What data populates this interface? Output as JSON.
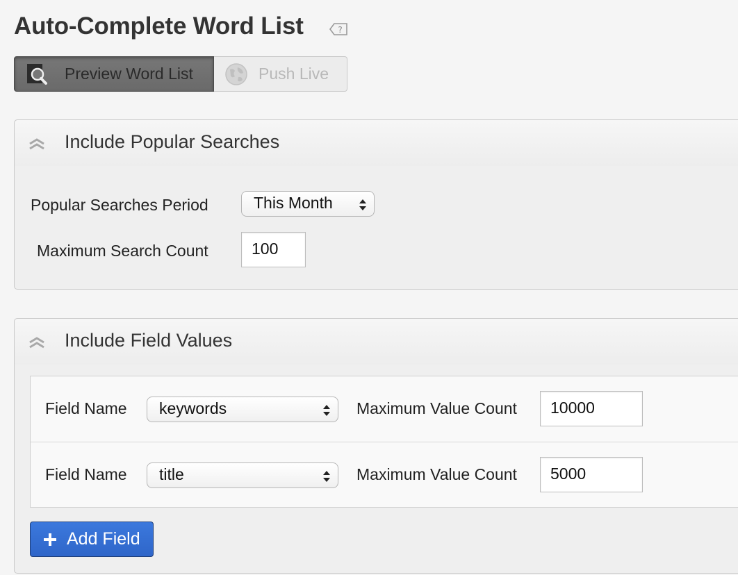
{
  "page": {
    "title": "Auto-Complete Word List",
    "help_icon": "help-tag-icon"
  },
  "toolbar": {
    "preview_label": "Preview Word List",
    "preview_icon": "magnify-document-icon",
    "push_label": "Push Live",
    "push_icon": "globe-icon",
    "push_enabled": false
  },
  "popular": {
    "title": "Include Popular Searches",
    "collapse_icon": "chevron-double-up-icon",
    "period_label": "Popular Searches Period",
    "period_value": "This Month",
    "max_label": "Maximum Search Count",
    "max_value": "100"
  },
  "fields": {
    "title": "Include Field Values",
    "collapse_icon": "chevron-double-up-icon",
    "rows": [
      {
        "name_label": "Field Name",
        "name_value": "keywords",
        "count_label": "Maximum Value Count",
        "count_value": "10000"
      },
      {
        "name_label": "Field Name",
        "name_value": "title",
        "count_label": "Maximum Value Count",
        "count_value": "5000"
      }
    ],
    "add_label": "Add Field",
    "add_icon": "plus-icon"
  },
  "colors": {
    "accent": "#3371d6",
    "preview_active": "#707070",
    "disabled_text": "#b8b8b8"
  }
}
